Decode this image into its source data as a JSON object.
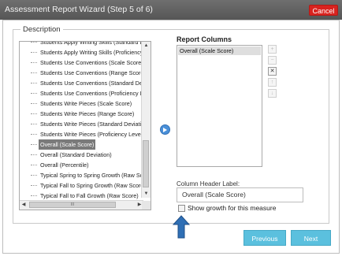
{
  "window": {
    "title": "Assessment Report Wizard (Step 5 of 6)",
    "cancel_label": "Cancel"
  },
  "fieldset": {
    "legend": "Description"
  },
  "available": {
    "items": [
      "Students Apply Writing Skills (Standard Deviat",
      "Students Apply Writing Skills (Proficiency Leve",
      "Students Use Conventions (Scale Score)",
      "Students Use Conventions (Range Score)",
      "Students Use Conventions (Standard Deviation",
      "Students Use Conventions (Proficiency Level)",
      "Students Write Pieces (Scale Score)",
      "Students Write Pieces (Range Score)",
      "Students Write Pieces (Standard Deviation)",
      "Students Write Pieces (Proficiency Level)",
      "Overall (Scale Score)",
      "Overall (Standard Deviation)",
      "Overall (Percentile)",
      "Typical Spring to Spring Growth (Raw Score)",
      "Typical Fall to Spring Growth (Raw Score)",
      "Typical Fall to Fall Growth (Raw Score)"
    ],
    "selected_index": 10,
    "hscroll_grip": "III"
  },
  "report_columns": {
    "title": "Report Columns",
    "items": [
      "Overall (Scale Score)"
    ]
  },
  "side_buttons": [
    "+",
    "−",
    "✕",
    "↑",
    "↓"
  ],
  "column_header": {
    "label": "Column Header Label:",
    "value": "Overall (Scale Score)"
  },
  "growth": {
    "label": "Show growth for this measure",
    "checked": false
  },
  "footer": {
    "previous_label": "Previous",
    "next_label": "Next"
  },
  "colors": {
    "titlebar": "#5f5f5f",
    "cancel": "#d9231f",
    "button": "#5bc0de",
    "selected": "#7a7a7a",
    "arrow": "#2f6fb5"
  }
}
